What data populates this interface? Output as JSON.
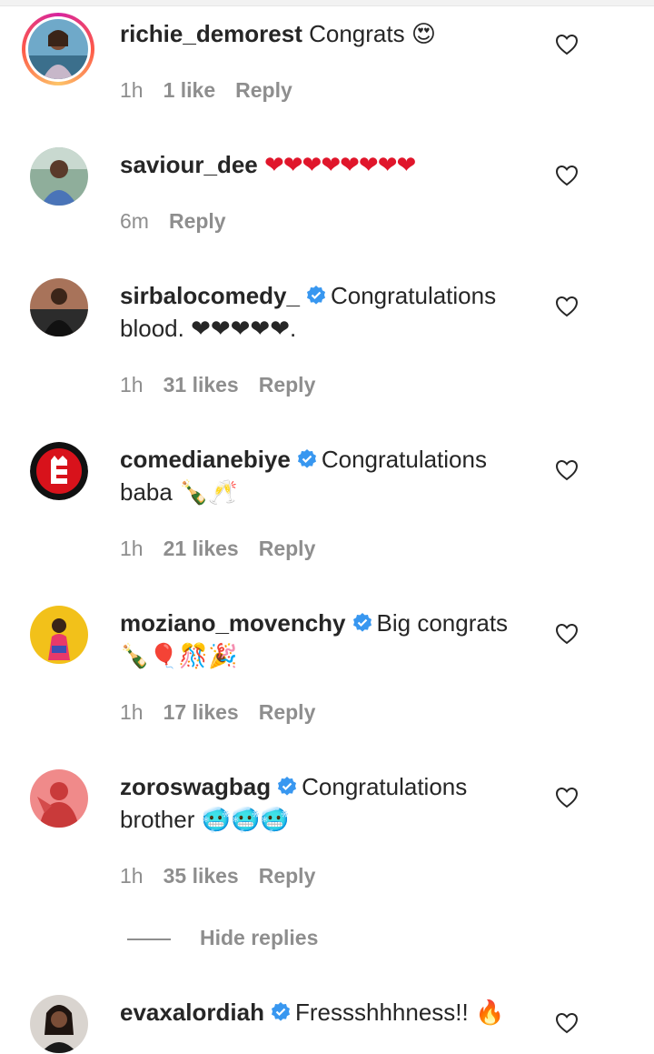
{
  "comments": [
    {
      "username": "richie_demorest",
      "verified": false,
      "text": "Congrats 😍",
      "time": "1h",
      "likes": "1 like",
      "reply": "Reply"
    },
    {
      "username": "saviour_dee",
      "verified": false,
      "text": "❤❤❤❤❤❤❤❤",
      "time": "6m",
      "likes": "",
      "reply": "Reply"
    },
    {
      "username": "sirbalocomedy_",
      "verified": true,
      "text": "Congratulations blood. ❤❤❤❤❤.",
      "time": "1h",
      "likes": "31 likes",
      "reply": "Reply"
    },
    {
      "username": "comedianebiye",
      "verified": true,
      "text": "Congratulations baba 🍾🥂",
      "time": "1h",
      "likes": "21 likes",
      "reply": "Reply"
    },
    {
      "username": "moziano_movenchy",
      "verified": true,
      "text": "Big congrats 🍾🎈🎊🎉",
      "time": "1h",
      "likes": "17 likes",
      "reply": "Reply"
    },
    {
      "username": "zoroswagbag",
      "verified": true,
      "text": "Congratulations brother 🥶🥶🥶",
      "time": "1h",
      "likes": "35 likes",
      "reply": "Reply"
    },
    {
      "username": "evaxalordiah",
      "verified": true,
      "text": "Fressshhhness!! 🔥"
    }
  ],
  "hide_replies": "Hide replies",
  "colors": {
    "text": "#262626",
    "meta": "#8e8e8e",
    "verified": "#3897f0",
    "heart_red": "#e0162b"
  },
  "icons": {
    "like": "heart-outline-icon",
    "verified": "verified-badge-icon"
  }
}
